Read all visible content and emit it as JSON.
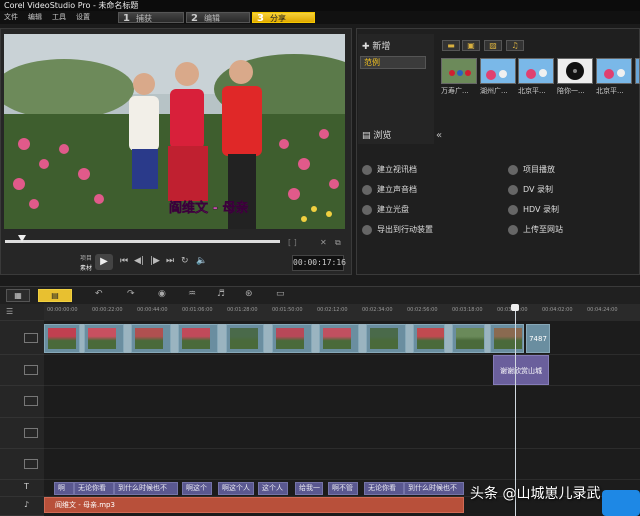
{
  "title_bar": {
    "text": "Corel VideoStudio Pro - 未命名标题"
  },
  "menu": [
    "文件",
    "编辑",
    "工具",
    "设置"
  ],
  "steps": [
    {
      "num": "1",
      "label": "捕获",
      "active": false
    },
    {
      "num": "2",
      "label": "编辑",
      "active": false
    },
    {
      "num": "3",
      "label": "分享",
      "active": true
    }
  ],
  "preview": {
    "subtitle": "阎维文 - 母亲",
    "mode_labels": [
      "项目",
      "素材"
    ],
    "timecode": "00:00:17:16"
  },
  "library": {
    "add_label": "新增",
    "selected_folder": "范例",
    "browse_label": "浏览",
    "thumbnails": [
      "万寿广...",
      "湖州广...",
      "北京平...",
      "陪你一...",
      "北京平..."
    ]
  },
  "actions_left": [
    "建立视讯档",
    "建立声音档",
    "建立光盘",
    "导出到行动装置"
  ],
  "actions_right": [
    "项目播放",
    "DV 录制",
    "HDV 录制",
    "上传至网站"
  ],
  "timeline": {
    "ruler_ticks": [
      "00:00:00:00",
      "00:00:22:00",
      "00:00:44:00",
      "00:01:06:00",
      "00:01:28:00",
      "00:01:50:00",
      "00:02:12:00",
      "00:02:34:00",
      "00:02:56:00",
      "00:03:18:00",
      "00:03:40:00",
      "00:04:02:00",
      "00:04:24:00"
    ],
    "clip_end_label": "7487",
    "title_clip": "谢谢欣赏山城",
    "lyrics": [
      "啊",
      "无论你看",
      "到什么时候也不",
      "啊这个",
      "啊这个人",
      "这个人",
      "给我一",
      "啊不管",
      "无论你看",
      "到什么时候也不"
    ],
    "audio_clip": "阎维文 - 母亲.mp3"
  },
  "watermark": "头条 @山城崽儿录武",
  "colors": {
    "accent": "#f0c020",
    "video_track": "#6a8ea0",
    "title_track": "#6a5f9c",
    "audio_track": "#b8503a"
  }
}
